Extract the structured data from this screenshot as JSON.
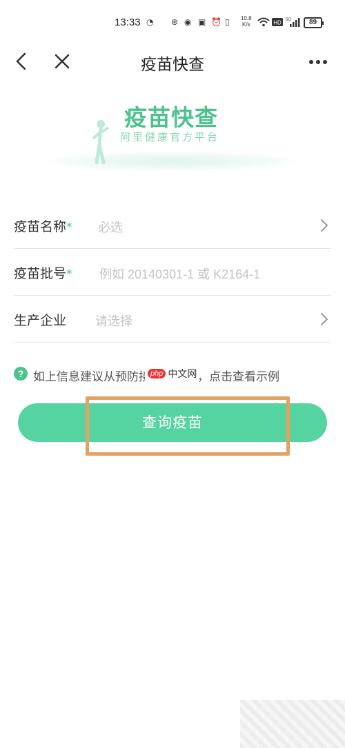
{
  "status_bar": {
    "time": "13:33",
    "net_speed_value": "10.8",
    "net_speed_unit": "K/s",
    "battery": "89"
  },
  "nav": {
    "title": "疫苗快查"
  },
  "banner": {
    "title": "疫苗快查",
    "subtitle": "阿里健康官方平台"
  },
  "form": {
    "rows": [
      {
        "label": "疫苗名称",
        "required": "*",
        "placeholder": "必选"
      },
      {
        "label": "疫苗批号",
        "required": "*",
        "placeholder": "例如 20140301-1 或 K2164-1"
      },
      {
        "label": "生产企业",
        "required": "",
        "placeholder": "请选择"
      }
    ]
  },
  "hint": {
    "text": "如上信息建议从预防接种证获取，点击查看示例"
  },
  "query_button": {
    "label": "查询疫苗"
  },
  "watermark": {
    "badge": "php",
    "text": "中文网"
  },
  "colors": {
    "accent": "#4dc28f",
    "button": "#55d3a0",
    "highlight_box": "#e6a060"
  }
}
